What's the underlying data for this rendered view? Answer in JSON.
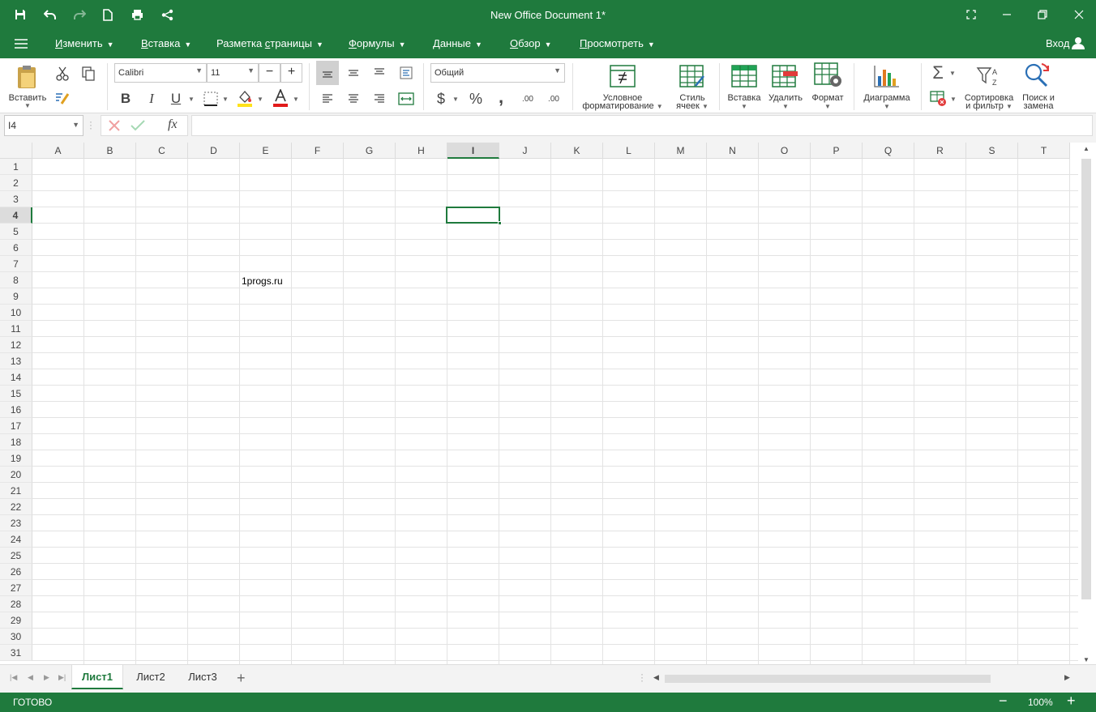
{
  "title": "New Office Document 1*",
  "menu": [
    "Изменить",
    "Вставка",
    "Разметка страницы",
    "Формулы",
    "Данные",
    "Обзор",
    "Просмотреть"
  ],
  "menu_underlines": [
    "И",
    "В",
    "с",
    "Ф",
    "Д",
    "О",
    "П"
  ],
  "login": "Вход",
  "ribbon": {
    "paste_label": "Вставить",
    "font_name": "Calibri",
    "font_size": "11",
    "bold": "B",
    "italic": "I",
    "underline": "U",
    "number_format": "Общий",
    "currency": "$",
    "percent": "%",
    "comma": ",",
    "inc_decimal": ".00",
    "dec_decimal": ".00",
    "cond_format_l1": "Условное",
    "cond_format_l2": "форматирование",
    "cell_style_l1": "Стиль",
    "cell_style_l2": "ячеек",
    "insert": "Вставка",
    "delete": "Удалить",
    "format": "Формат",
    "chart": "Диаграмма",
    "sort_l1": "Сортировка",
    "sort_l2": "и фильтр",
    "find_l1": "Поиск и",
    "find_l2": "замена"
  },
  "formula_bar": {
    "cell_ref": "I4",
    "fx": "fx",
    "value": ""
  },
  "grid": {
    "columns": [
      "A",
      "B",
      "C",
      "D",
      "E",
      "F",
      "G",
      "H",
      "I",
      "J",
      "K",
      "L",
      "M",
      "N",
      "O",
      "P",
      "Q",
      "R",
      "S",
      "T"
    ],
    "rows": [
      "1",
      "2",
      "3",
      "4",
      "5",
      "6",
      "7",
      "8",
      "9",
      "10",
      "11",
      "12",
      "13",
      "14",
      "15",
      "16",
      "17",
      "18",
      "19",
      "20",
      "21",
      "22",
      "23",
      "24",
      "25",
      "26",
      "27",
      "28",
      "29",
      "30",
      "31"
    ],
    "active_cell": "I4",
    "cell_E8": "1progs.ru"
  },
  "sheets": [
    "Лист1",
    "Лист2",
    "Лист3"
  ],
  "active_sheet": "Лист1",
  "status": {
    "ready": "ГОТОВО",
    "zoom": "100%"
  },
  "colors": {
    "brand": "#1f7a3d",
    "accent_green": "#21a356"
  }
}
